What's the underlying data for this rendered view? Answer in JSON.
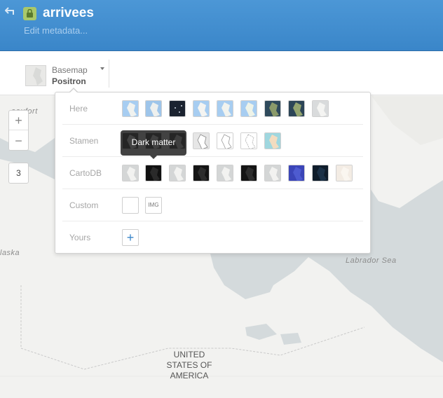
{
  "header": {
    "title": "arrivees",
    "subtitle": "Edit metadata..."
  },
  "toolbar": {
    "basemap_label": "Basemap",
    "basemap_value": "Positron"
  },
  "map": {
    "labels": {
      "beaufort": "eaufort",
      "alaska": "laska",
      "labrador_sea": "Labrador Sea",
      "country_line1": "UNITED",
      "country_line2": "STATES OF",
      "country_line3": "AMERICA"
    },
    "zoom_in": "+",
    "zoom_out": "−",
    "zoom_level": "3"
  },
  "panel": {
    "rows": [
      {
        "label": "Here"
      },
      {
        "label": "Stamen"
      },
      {
        "label": "CartoDB"
      },
      {
        "label": "Custom"
      },
      {
        "label": "Yours"
      }
    ],
    "img_button": "IMG",
    "add_button": "+"
  },
  "tooltip": {
    "text": "Dark matter"
  },
  "colors": {
    "header": "#4c97d6",
    "accent": "#3a86c9",
    "map_land": "#f2f2f0",
    "map_water": "#d4dadc"
  }
}
